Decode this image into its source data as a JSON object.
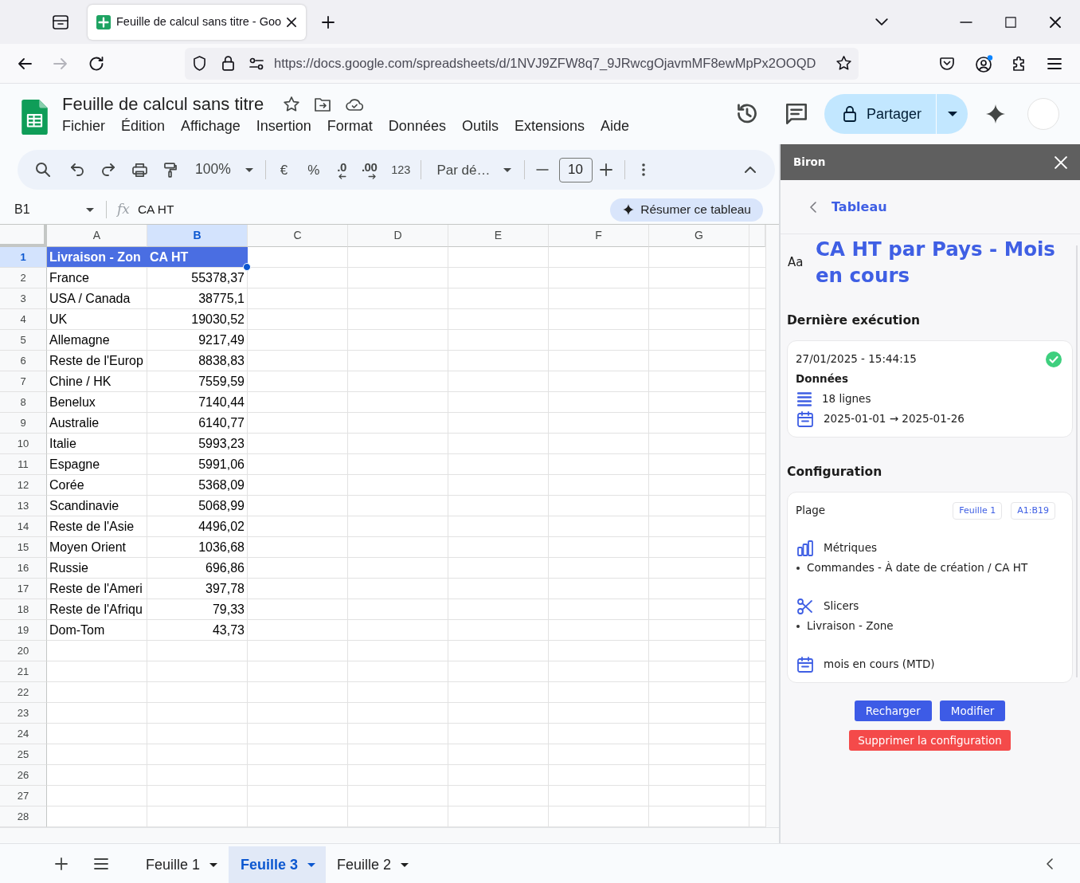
{
  "browser": {
    "tab_title": "Feuille de calcul sans titre - Goo",
    "url": "https://docs.google.com/spreadsheets/d/1NVJ9ZFW8q7_9JRwcgOjavmMF8ewMpPx2OOQD",
    "forward_disabled": true
  },
  "app_header": {
    "doc_title": "Feuille de calcul sans titre",
    "menu": [
      "Fichier",
      "Édition",
      "Affichage",
      "Insertion",
      "Format",
      "Données",
      "Outils",
      "Extensions",
      "Aide"
    ],
    "share_button": "Partager"
  },
  "toolbar": {
    "zoom": "100%",
    "currency": "€",
    "percent": "%",
    "decrease_decimals": ".0",
    "increase_decimals": ".00",
    "number_format": "123",
    "font": "Par dé…",
    "font_size": "10"
  },
  "formula_bar": {
    "cell_ref": "B1",
    "function_label": "fx",
    "content": "CA HT",
    "summarize_button": "Résumer ce tableau"
  },
  "grid": {
    "columns": [
      {
        "label": "A",
        "selected": false
      },
      {
        "label": "B",
        "selected": true
      },
      {
        "label": "C",
        "selected": false
      },
      {
        "label": "D",
        "selected": false
      },
      {
        "label": "E",
        "selected": false
      },
      {
        "label": "F",
        "selected": false
      },
      {
        "label": "G",
        "selected": false
      }
    ],
    "rows": [
      {
        "number": "1",
        "selected": true,
        "kind": "header",
        "cells": [
          "Livraison - Zon",
          "CA HT"
        ]
      },
      {
        "number": "2",
        "selected": false,
        "kind": "data",
        "cells": [
          "France",
          "55378,37"
        ]
      },
      {
        "number": "3",
        "selected": false,
        "kind": "data",
        "cells": [
          "USA / Canada",
          "38775,1"
        ]
      },
      {
        "number": "4",
        "selected": false,
        "kind": "data",
        "cells": [
          "UK",
          "19030,52"
        ]
      },
      {
        "number": "5",
        "selected": false,
        "kind": "data",
        "cells": [
          "Allemagne",
          "9217,49"
        ]
      },
      {
        "number": "6",
        "selected": false,
        "kind": "data",
        "cells": [
          "Reste de l'Europ",
          "8838,83"
        ]
      },
      {
        "number": "7",
        "selected": false,
        "kind": "data",
        "cells": [
          "Chine / HK",
          "7559,59"
        ]
      },
      {
        "number": "8",
        "selected": false,
        "kind": "data",
        "cells": [
          "Benelux",
          "7140,44"
        ]
      },
      {
        "number": "9",
        "selected": false,
        "kind": "data",
        "cells": [
          "Australie",
          "6140,77"
        ]
      },
      {
        "number": "10",
        "selected": false,
        "kind": "data",
        "cells": [
          "Italie",
          "5993,23"
        ]
      },
      {
        "number": "11",
        "selected": false,
        "kind": "data",
        "cells": [
          "Espagne",
          "5991,06"
        ]
      },
      {
        "number": "12",
        "selected": false,
        "kind": "data",
        "cells": [
          "Corée",
          "5368,09"
        ]
      },
      {
        "number": "13",
        "selected": false,
        "kind": "data",
        "cells": [
          "Scandinavie",
          "5068,99"
        ]
      },
      {
        "number": "14",
        "selected": false,
        "kind": "data",
        "cells": [
          "Reste de l'Asie",
          "4496,02"
        ]
      },
      {
        "number": "15",
        "selected": false,
        "kind": "data",
        "cells": [
          "Moyen Orient",
          "1036,68"
        ]
      },
      {
        "number": "16",
        "selected": false,
        "kind": "data",
        "cells": [
          "Russie",
          "696,86"
        ]
      },
      {
        "number": "17",
        "selected": false,
        "kind": "data",
        "cells": [
          "Reste de l'Ameri",
          "397,78"
        ]
      },
      {
        "number": "18",
        "selected": false,
        "kind": "data",
        "cells": [
          "Reste de l'Afriqu",
          "79,33"
        ]
      },
      {
        "number": "19",
        "selected": false,
        "kind": "data",
        "cells": [
          "Dom-Tom",
          "43,73"
        ]
      },
      {
        "number": "20",
        "selected": false
      },
      {
        "number": "21",
        "selected": false
      },
      {
        "number": "22",
        "selected": false
      },
      {
        "number": "23",
        "selected": false
      },
      {
        "number": "24",
        "selected": false
      },
      {
        "number": "25",
        "selected": false
      },
      {
        "number": "26",
        "selected": false
      },
      {
        "number": "27",
        "selected": false
      },
      {
        "number": "28",
        "selected": false
      }
    ]
  },
  "sheet_tabs": [
    {
      "label": "Feuille 1",
      "selected": false
    },
    {
      "label": "Feuille 3",
      "selected": true
    },
    {
      "label": "Feuille 2",
      "selected": false
    }
  ],
  "side_panel": {
    "title": "Biron",
    "back_link": "Tableau",
    "title_icon": "Aa",
    "report_title": "CA HT par Pays - Mois en cours",
    "last_run": {
      "heading": "Dernière exécution",
      "timestamp": "27/01/2025 - 15:44:15",
      "success": true,
      "data_label": "Données",
      "row_count": "18 lignes",
      "date_range": "2025-01-01 → 2025-01-26"
    },
    "configuration": {
      "heading": "Configuration",
      "range_label": "Plage",
      "range_tags": [
        "Feuille 1",
        "A1:B19"
      ],
      "sections": [
        {
          "kind": "metrics",
          "label": "Métriques",
          "items": [
            "Commandes - À date de création / CA HT"
          ]
        },
        {
          "kind": "slicers",
          "label": "Slicers",
          "items": [
            "Livraison - Zone"
          ]
        },
        {
          "kind": "period",
          "label": "mois en cours (MTD)"
        }
      ]
    },
    "actions": [
      {
        "label": "Recharger",
        "kind": "primary"
      },
      {
        "label": "Modifier",
        "kind": "primary"
      },
      {
        "label": "Supprimer la configuration",
        "kind": "danger"
      }
    ]
  }
}
